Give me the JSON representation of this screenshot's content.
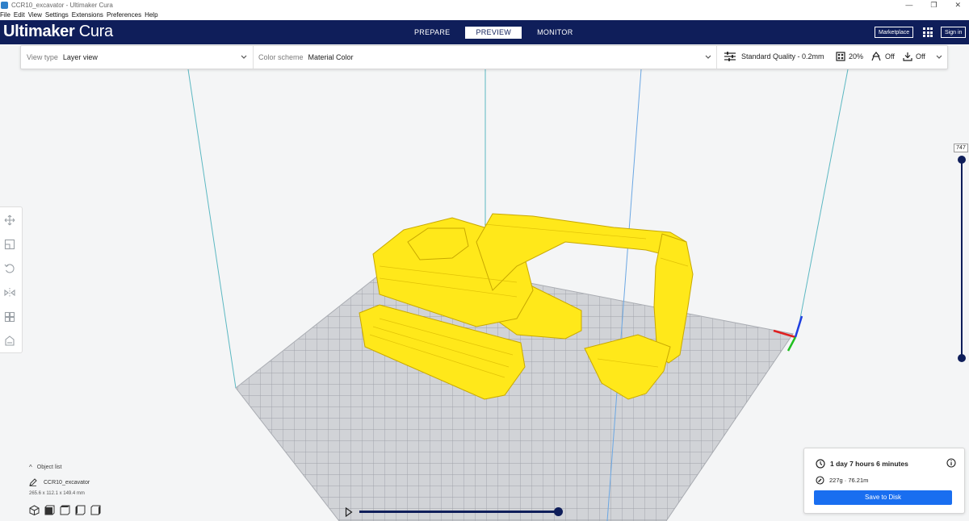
{
  "window": {
    "title": "CCR10_excavator - Ultimaker Cura",
    "controls": [
      "—",
      "❐",
      "✕"
    ]
  },
  "menu": [
    "File",
    "Edit",
    "View",
    "Settings",
    "Extensions",
    "Preferences",
    "Help"
  ],
  "header": {
    "brand": "Ultimaker",
    "brand2": " Cura",
    "tabs": [
      "PREPARE",
      "PREVIEW",
      "MONITOR"
    ],
    "active_tab": "PREVIEW",
    "marketplace": "Marketplace",
    "signin": "Sign in"
  },
  "settings_bar": {
    "view_type_label": "View type",
    "view_type_value": "Layer view",
    "color_scheme_label": "Color scheme",
    "color_scheme_value": "Material Color",
    "quality": "Standard Quality - 0.2mm",
    "infill": "20%",
    "support": "Off",
    "adhesion": "Off"
  },
  "layer_slider": {
    "value": "747"
  },
  "object_list": {
    "toggle_label": "Object list",
    "object_name": "CCR10_excavator",
    "dimensions": "265.6 x 112.1 x 149.4 mm"
  },
  "print_info": {
    "time": "1 day 7 hours 6 minutes",
    "material": "227g · 76.21m",
    "save_label": "Save to Disk"
  },
  "colors": {
    "header": "#0f1e5a",
    "accent": "#196ef0",
    "model": "#ffe81a",
    "bed": "#c5c7cc"
  },
  "icons": {
    "tools": [
      "move-icon",
      "scale-icon",
      "rotate-icon",
      "mirror-icon",
      "per-model-settings-icon",
      "support-blocker-icon"
    ],
    "view_modes": [
      "3d-view-icon",
      "front-view-icon",
      "top-view-icon",
      "left-view-icon",
      "right-view-icon"
    ]
  }
}
